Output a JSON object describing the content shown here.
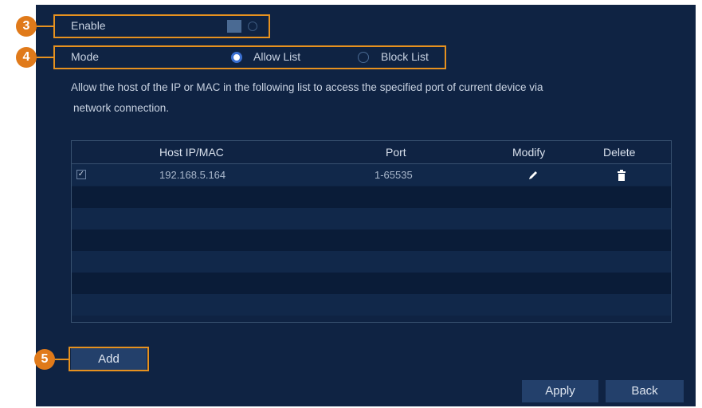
{
  "callouts": {
    "enable": "3",
    "mode": "4",
    "add": "5"
  },
  "enable": {
    "label": "Enable",
    "state": "off"
  },
  "mode": {
    "label": "Mode",
    "options": [
      {
        "label": "Allow List",
        "selected": true
      },
      {
        "label": "Block List",
        "selected": false
      }
    ]
  },
  "description": {
    "line1": "Allow the host of the IP or MAC in the following list to access the specified port of current device via",
    "line2": "network connection."
  },
  "table": {
    "headers": {
      "host": "Host IP/MAC",
      "port": "Port",
      "modify": "Modify",
      "delete": "Delete"
    },
    "rows": [
      {
        "checked": true,
        "host": "192.168.5.164",
        "port": "1-65535"
      }
    ]
  },
  "buttons": {
    "add": "Add",
    "apply": "Apply",
    "back": "Back"
  },
  "icons": {
    "checkbox": "check-icon",
    "modify": "pencil-icon",
    "delete": "trash-icon"
  },
  "colors": {
    "panel": "#0f2343",
    "callout": "#e6911f",
    "button": "#23406b",
    "radio_on": "#3a6fd0"
  }
}
